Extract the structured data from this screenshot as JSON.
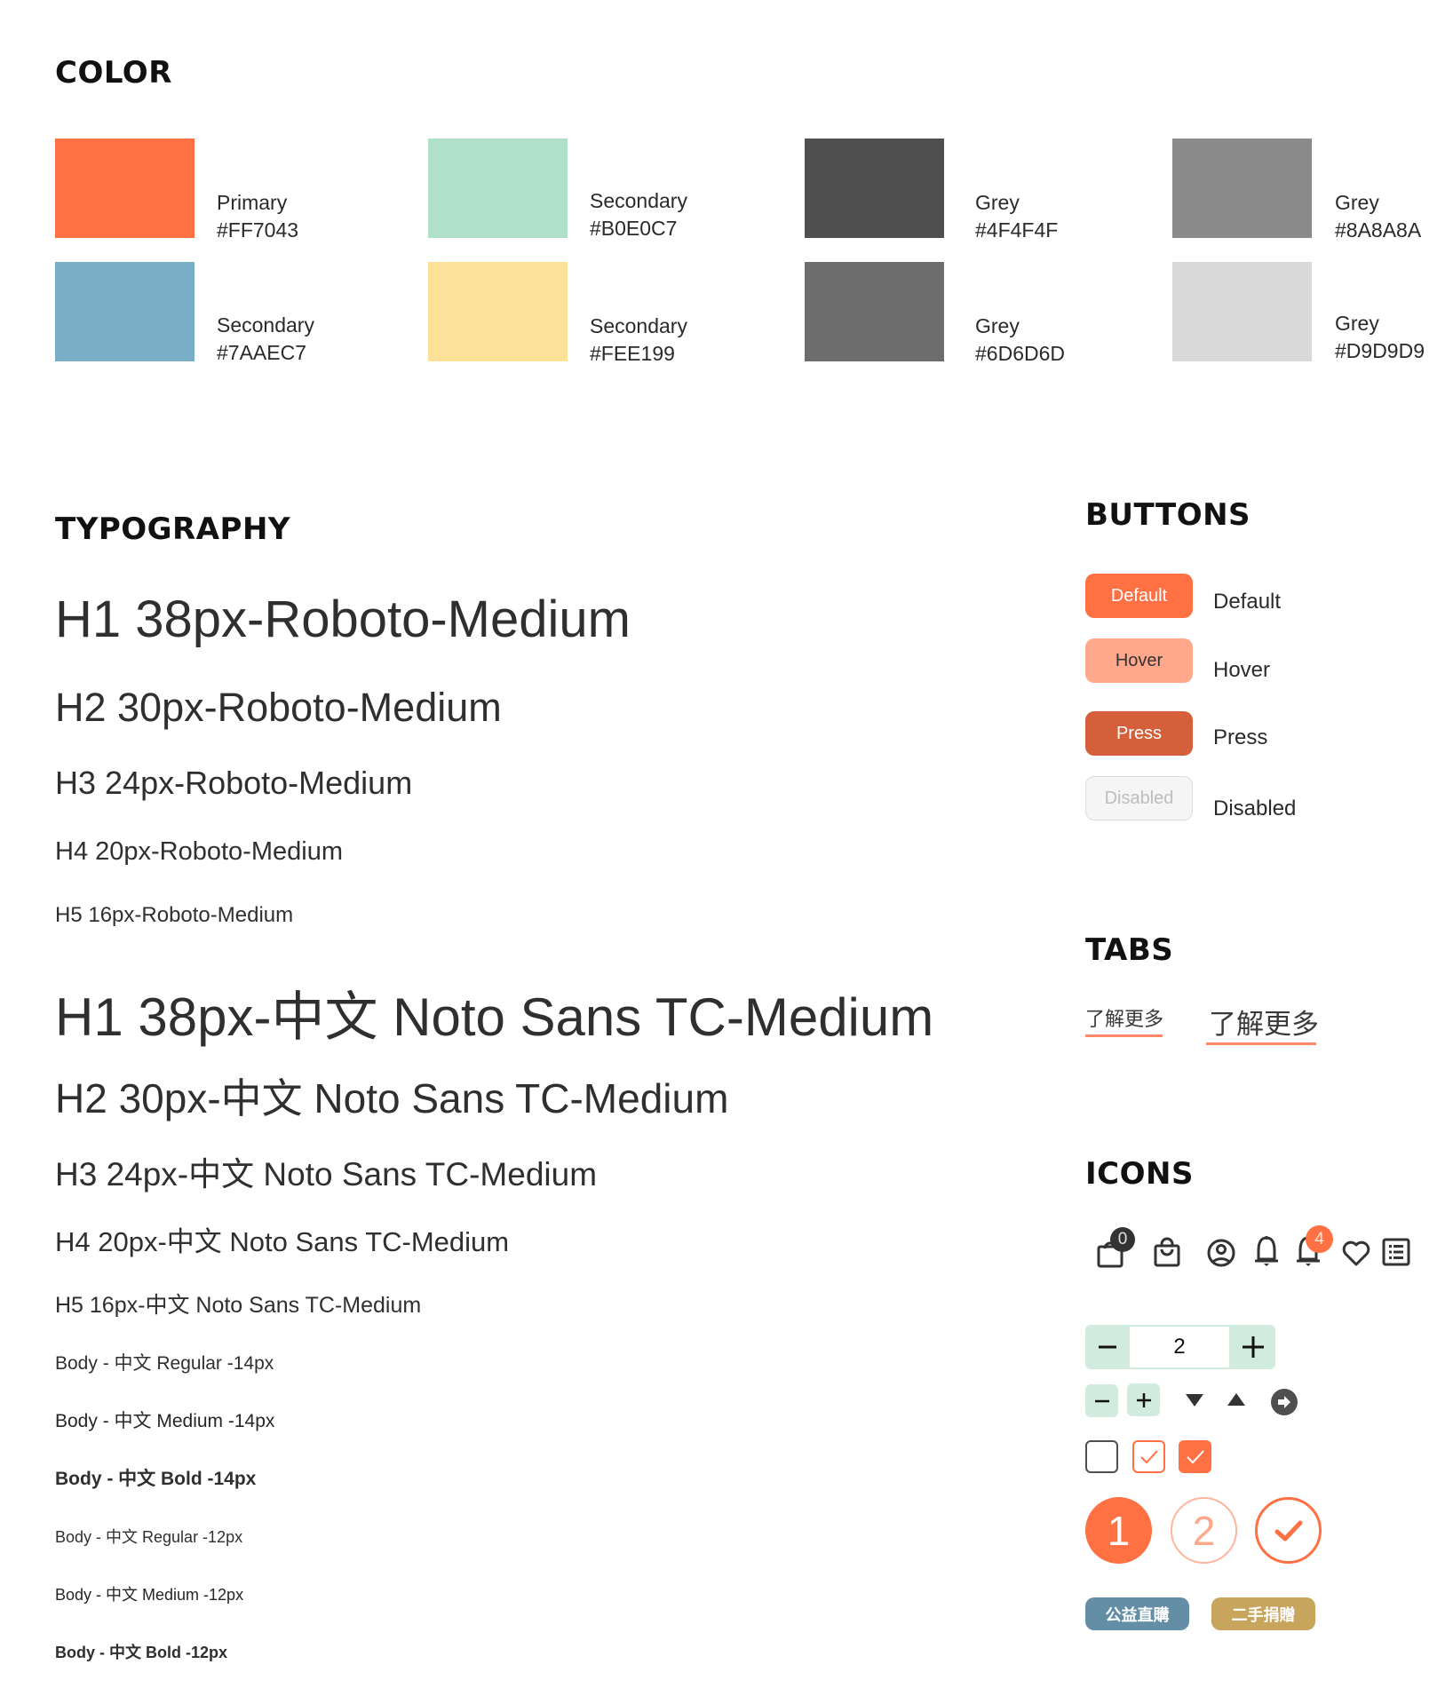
{
  "color": {
    "title": "COLOR",
    "swatches": [
      {
        "name": "Primary",
        "hex": "#FF7043"
      },
      {
        "name": "Secondary",
        "hex": "#7AAEC7"
      },
      {
        "name": "Secondary",
        "hex": "#B0E0C7"
      },
      {
        "name": "Secondary",
        "hex": "#FEE199"
      },
      {
        "name": "Grey",
        "hex": "#4F4F4F"
      },
      {
        "name": "Grey",
        "hex": "#6D6D6D"
      },
      {
        "name": "Grey",
        "hex": "#8A8A8A"
      },
      {
        "name": "Grey",
        "hex": "#D9D9D9"
      }
    ]
  },
  "typography": {
    "title": "TYPOGRAPHY",
    "roboto": [
      "H1 38px-Roboto-Medium",
      "H2 30px-Roboto-Medium",
      "H3 24px-Roboto-Medium",
      "H4 20px-Roboto-Medium",
      "H5 16px-Roboto-Medium"
    ],
    "noto": [
      "H1 38px-中文 Noto Sans TC-Medium",
      "H2 30px-中文 Noto Sans TC-Medium",
      "H3 24px-中文 Noto Sans TC-Medium",
      "H4 20px-中文 Noto Sans TC-Medium",
      "H5 16px-中文 Noto Sans TC-Medium"
    ],
    "body": [
      "Body - 中文 Regular -14px",
      "Body - 中文 Medium -14px",
      "Body - 中文 Bold -14px",
      "Body - 中文 Regular -12px",
      "Body - 中文 Medium -12px",
      "Body - 中文 Bold -12px"
    ]
  },
  "buttons": {
    "title": "BUTTONS",
    "states": [
      {
        "label": "Default",
        "desc": "Default"
      },
      {
        "label": "Hover",
        "desc": "Hover"
      },
      {
        "label": "Press",
        "desc": "Press"
      },
      {
        "label": "Disabled",
        "desc": "Disabled"
      }
    ]
  },
  "tabs": {
    "title": "TABS",
    "items": [
      "了解更多",
      "了解更多"
    ],
    "accent": "#FF8A65"
  },
  "icons": {
    "title": "ICONS",
    "cart_badge": "0",
    "notification_badge": "4",
    "stepper_value": "2",
    "stepper_minus": "−",
    "stepper_plus": "+",
    "steps": [
      "1",
      "2"
    ],
    "tags": [
      "公益直購",
      "二手捐贈"
    ],
    "tag_colors": [
      "#648EA5",
      "#C8A55C"
    ]
  }
}
